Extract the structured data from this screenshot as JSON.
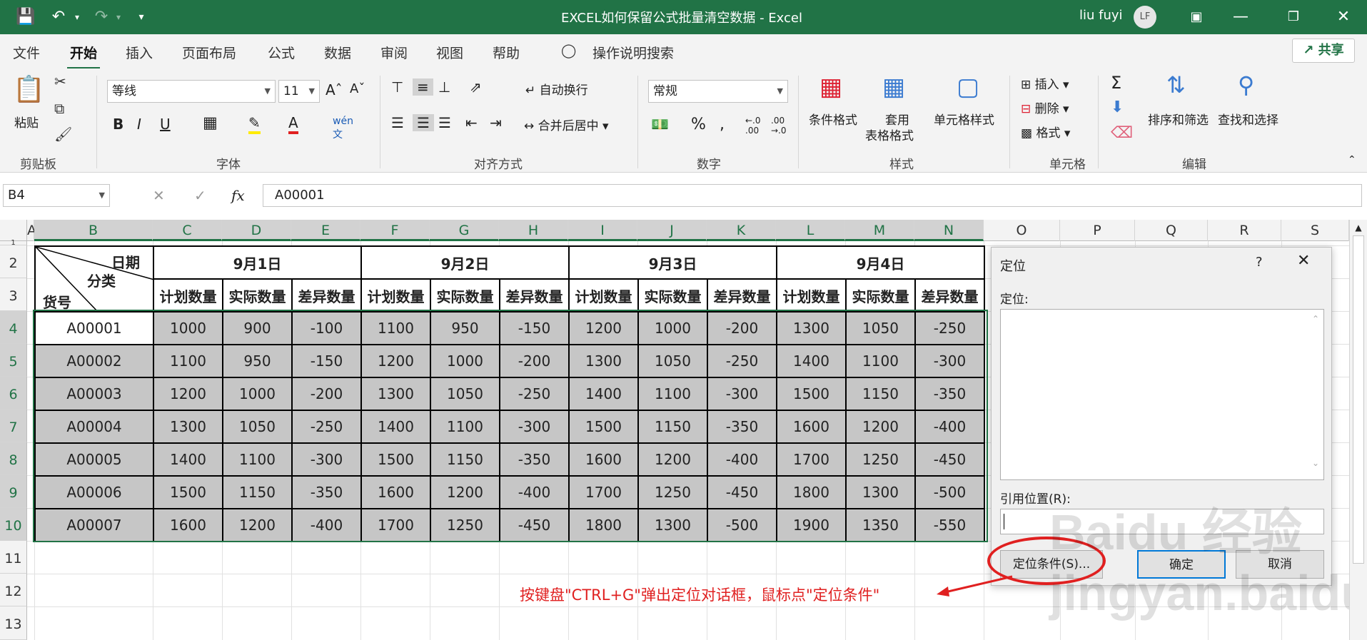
{
  "window": {
    "title": "EXCEL如何保留公式批量清空数据 - Excel",
    "user": "liu fuyi",
    "avatar": "LF"
  },
  "menu": [
    "文件",
    "开始",
    "插入",
    "页面布局",
    "公式",
    "数据",
    "审阅",
    "视图",
    "帮助",
    "操作说明搜索"
  ],
  "share": "共享",
  "ribbon": {
    "paste": "粘贴",
    "font_name": "等线",
    "font_size": "11",
    "wrap": "自动换行",
    "merge": "合并后居中",
    "number_format": "常规",
    "cond_format": "条件格式",
    "table_format_1": "套用",
    "table_format_2": "表格格式",
    "cell_style": "单元格样式",
    "insert": "插入",
    "delete": "删除",
    "format": "格式",
    "sort": "排序和筛选",
    "find": "查找和选择",
    "groups": [
      "剪贴板",
      "字体",
      "对齐方式",
      "数字",
      "样式",
      "单元格",
      "编辑"
    ]
  },
  "formula_bar": {
    "name_box": "B4",
    "value": "A00001"
  },
  "columns": [
    "A",
    "B",
    "C",
    "D",
    "E",
    "F",
    "G",
    "H",
    "I",
    "J",
    "K",
    "L",
    "M",
    "N",
    "O",
    "P",
    "Q",
    "R",
    "S"
  ],
  "rows": [
    "1",
    "2",
    "3",
    "4",
    "5",
    "6",
    "7",
    "8",
    "9",
    "10",
    "11",
    "12",
    "13"
  ],
  "sheet": {
    "corner_date": "日期",
    "corner_cat": "分类",
    "corner_id": "货号",
    "dates": [
      "9月1日",
      "9月2日",
      "9月3日",
      "9月4日"
    ],
    "subheaders": [
      "计划数量",
      "实际数量",
      "差异数量"
    ],
    "data": [
      [
        "A00001",
        "1000",
        "900",
        "-100",
        "1100",
        "950",
        "-150",
        "1200",
        "1000",
        "-200",
        "1300",
        "1050",
        "-250"
      ],
      [
        "A00002",
        "1100",
        "950",
        "-150",
        "1200",
        "1000",
        "-200",
        "1300",
        "1050",
        "-250",
        "1400",
        "1100",
        "-300"
      ],
      [
        "A00003",
        "1200",
        "1000",
        "-200",
        "1300",
        "1050",
        "-250",
        "1400",
        "1100",
        "-300",
        "1500",
        "1150",
        "-350"
      ],
      [
        "A00004",
        "1300",
        "1050",
        "-250",
        "1400",
        "1100",
        "-300",
        "1500",
        "1150",
        "-350",
        "1600",
        "1200",
        "-400"
      ],
      [
        "A00005",
        "1400",
        "1100",
        "-300",
        "1500",
        "1150",
        "-350",
        "1600",
        "1200",
        "-400",
        "1700",
        "1250",
        "-450"
      ],
      [
        "A00006",
        "1500",
        "1150",
        "-350",
        "1600",
        "1200",
        "-400",
        "1700",
        "1250",
        "-450",
        "1800",
        "1300",
        "-500"
      ],
      [
        "A00007",
        "1600",
        "1200",
        "-400",
        "1700",
        "1250",
        "-450",
        "1800",
        "1300",
        "-500",
        "1900",
        "1350",
        "-550"
      ]
    ]
  },
  "dialog": {
    "title": "定位",
    "help": "?",
    "goto_label": "定位:",
    "ref_label": "引用位置(R):",
    "special_btn": "定位条件(S)...",
    "ok_btn": "确定",
    "cancel_btn": "取消"
  },
  "annotation": "按键盘\"CTRL+G\"弹出定位对话框，鼠标点\"定位条件\"",
  "watermark": "Baidu 经验 jingyan.baidu.com",
  "colors": {
    "excel_green": "#217346",
    "annotation_red": "#e02020",
    "selection_fill": "#c6c6c6"
  }
}
